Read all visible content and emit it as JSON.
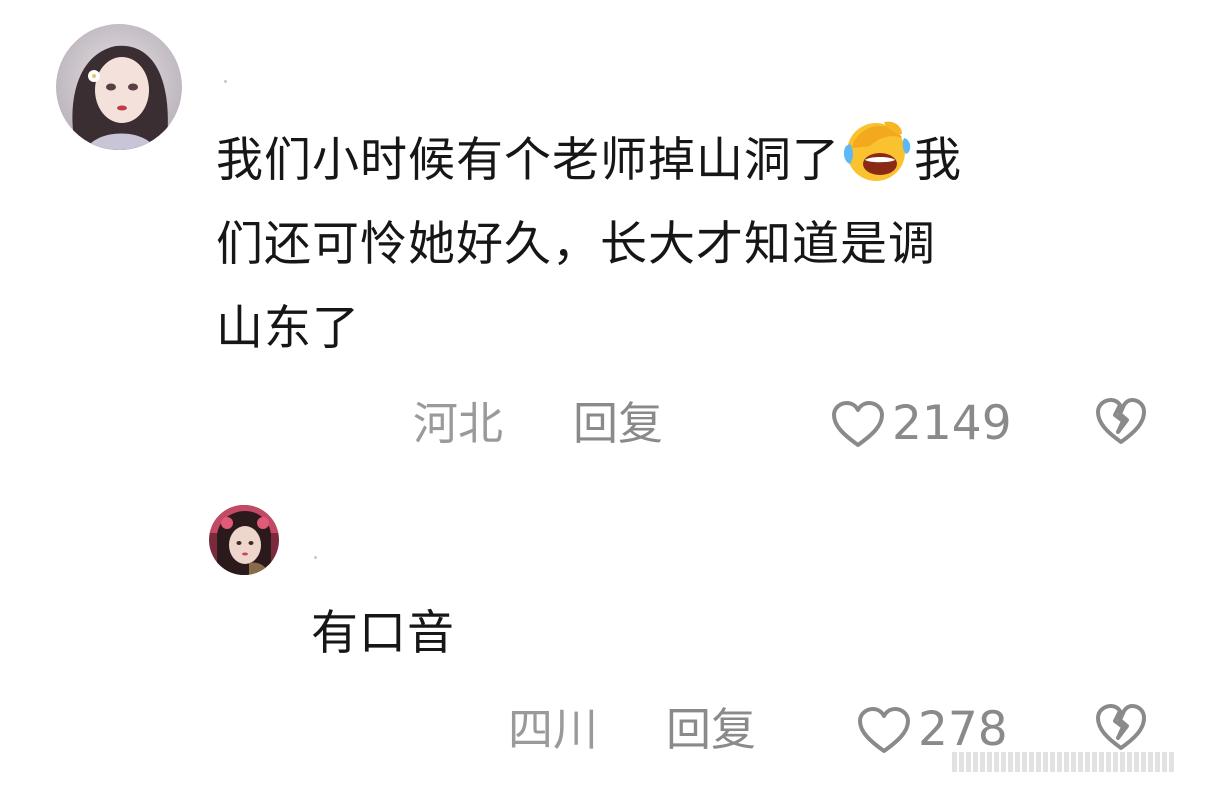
{
  "comments": [
    {
      "avatar": "anime-girl-avatar",
      "text_line1_part1": "我们小时候有个老师掉山洞了",
      "emoji": "laughing-crying-emoji",
      "text_line1_part2": "我",
      "text_line2": "们还可怜她好久，长大才知道是调",
      "text_line3": "山东了",
      "location": "河北",
      "reply_label": "回复",
      "like_count": "2149",
      "dislike_icon": "broken-heart-icon"
    },
    {
      "avatar": "girl-photo-avatar",
      "text": "有口音",
      "location": "四川",
      "reply_label": "回复",
      "like_count": "278",
      "dislike_icon": "broken-heart-icon"
    }
  ],
  "colors": {
    "text": "#161616",
    "meta": "#9a9a9a",
    "icon": "#8a8a8a"
  }
}
